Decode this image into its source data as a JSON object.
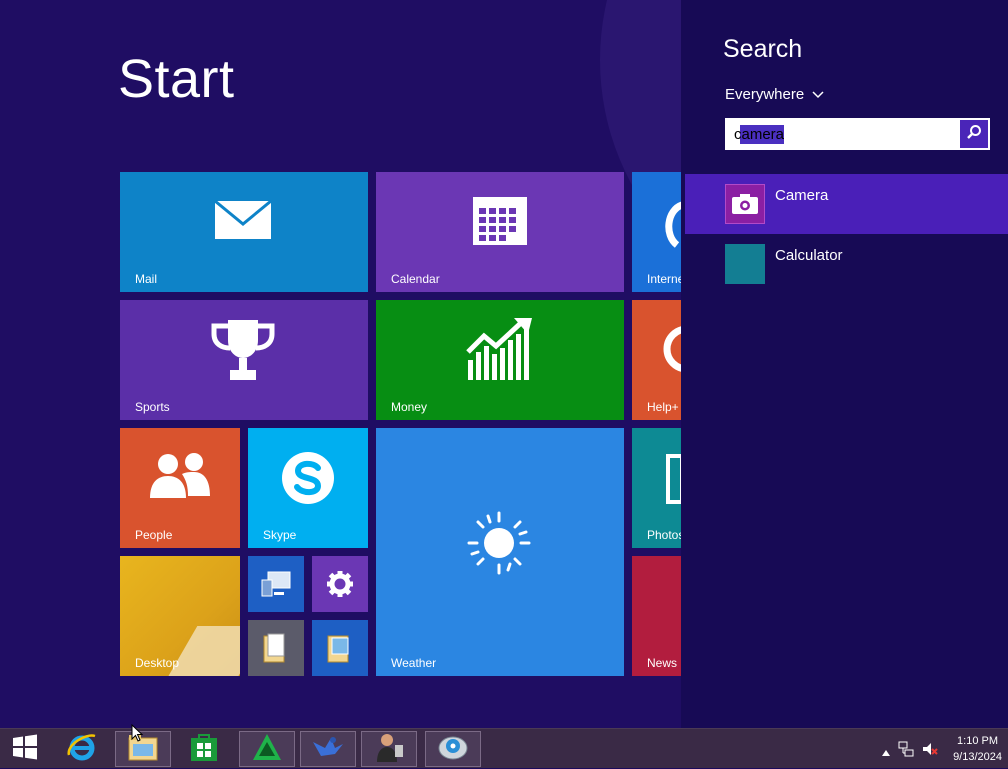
{
  "start": {
    "title": "Start"
  },
  "tiles": {
    "mail": "Mail",
    "calendar": "Calendar",
    "internet": "Interne",
    "sports": "Sports",
    "money": "Money",
    "help": "Help+",
    "people": "People",
    "skype": "Skype",
    "weather": "Weather",
    "photos": "Photos",
    "desktop": "Desktop",
    "news": "News"
  },
  "search": {
    "title": "Search",
    "scope": "Everywhere",
    "query": "camera",
    "results": [
      {
        "label": "Camera",
        "icon": "camera-icon",
        "color": "#8b1fa3"
      },
      {
        "label": "Calculator",
        "icon": "calculator-icon",
        "color": "#137e93"
      }
    ]
  },
  "taskbar": {
    "items": [
      "start-button",
      "internet-explorer",
      "file-explorer",
      "store",
      "app-green-triangle",
      "app-bird",
      "app-person",
      "app-globe-disc"
    ],
    "clock_time": "1:10 PM",
    "clock_date": "9/13/2024"
  },
  "colors": {
    "start_bg": "#1f0d63",
    "search_bg": "#170a55",
    "accent": "#4a25b8",
    "mail": "#0e83c8",
    "calendar": "#6b37b4",
    "sports": "#5b2fa8",
    "money": "#078e13",
    "people": "#d9532e",
    "skype": "#00aff0",
    "weather": "#2b86e2",
    "desktop": "#e3b020"
  }
}
